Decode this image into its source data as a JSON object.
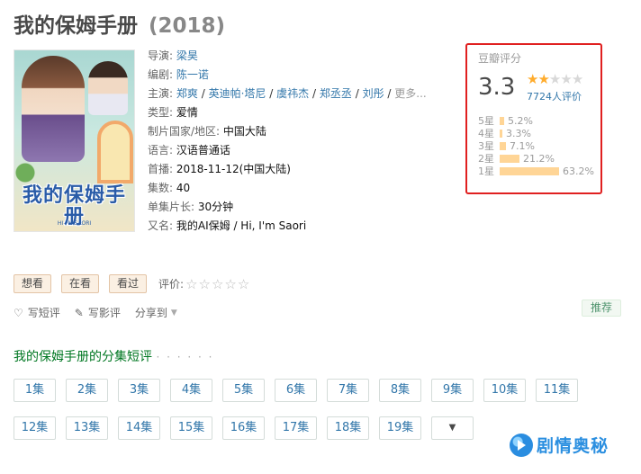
{
  "header": {
    "title": "我的保姆手册",
    "year": "(2018)"
  },
  "info": {
    "director_label": "导演:",
    "director": "梁昊",
    "writer_label": "编剧:",
    "writer": "陈一诺",
    "cast_label": "主演:",
    "cast": [
      "郑爽",
      "英迪帕·塔尼",
      "虞祎杰",
      "郑丞丞",
      "刘彤"
    ],
    "cast_sep": "/",
    "cast_more": "更多...",
    "genre_label": "类型:",
    "genre": "爱情",
    "country_label": "制片国家/地区:",
    "country": "中国大陆",
    "language_label": "语言:",
    "language": "汉语普通话",
    "premiere_label": "首播:",
    "premiere": "2018-11-12(中国大陆)",
    "episodes_label": "集数:",
    "episodes": "40",
    "runtime_label": "单集片长:",
    "runtime": "30分钟",
    "aka_label": "又名:",
    "aka": "我的AI保姆 / Hi, I'm Saori"
  },
  "poster": {
    "title_art": "我的保姆手册",
    "subtitle_art": "HI I'M SAORI"
  },
  "rating": {
    "source": "豆瓣评分",
    "score": "3.3",
    "stars_full": 1,
    "stars_half": 1,
    "stars_total": 5,
    "votes": "7724人评价",
    "distribution": [
      {
        "label": "5星",
        "percent": "5.2%",
        "value": 5.2
      },
      {
        "label": "4星",
        "percent": "3.3%",
        "value": 3.3
      },
      {
        "label": "3星",
        "percent": "7.1%",
        "value": 7.1
      },
      {
        "label": "2星",
        "percent": "21.2%",
        "value": 21.2
      },
      {
        "label": "1星",
        "percent": "63.2%",
        "value": 63.2
      }
    ],
    "bar_color": "#ffd596"
  },
  "actions": {
    "want_to_watch": "想看",
    "watching": "在看",
    "watched": "看过",
    "rate_label": "评价:",
    "rate_stars": "☆☆☆☆☆"
  },
  "actions2": {
    "short_review": "写短评",
    "review": "写影评",
    "share": "分享到"
  },
  "recommend": "推荐",
  "section": {
    "title": "我的保姆手册的分集短评",
    "dots": "· · · · · ·"
  },
  "episode_buttons": [
    "1集",
    "2集",
    "3集",
    "4集",
    "5集",
    "6集",
    "7集",
    "8集",
    "9集",
    "10集",
    "11集",
    "12集",
    "13集",
    "14集",
    "15集",
    "16集",
    "17集",
    "18集",
    "19集"
  ],
  "episode_more_icon": "caret-down-icon",
  "watermark": "剧情奥秘",
  "colors": {
    "link": "#3377aa",
    "section_green": "#007722",
    "highlight_border": "#e02020",
    "star": "#ffac2d"
  }
}
